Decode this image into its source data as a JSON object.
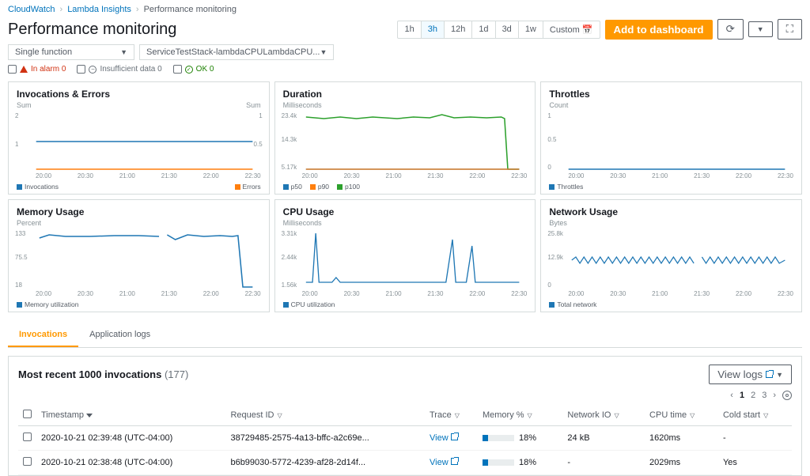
{
  "breadcrumb": {
    "root": "CloudWatch",
    "mid": "Lambda Insights",
    "cur": "Performance monitoring"
  },
  "title": "Performance monitoring",
  "time_ranges": [
    "1h",
    "3h",
    "12h",
    "1d",
    "3d",
    "1w",
    "Custom 📅"
  ],
  "time_active": "3h",
  "add_btn": "Add to dashboard",
  "selectors": {
    "mode": "Single function",
    "fn": "ServiceTestStack-lambdaCPULambdaCPU..."
  },
  "status": {
    "alarm": "In alarm 0",
    "insuf": "Insufficient data 0",
    "ok": "OK 0"
  },
  "panels": {
    "inv": {
      "title": "Invocations & Errors",
      "sub": "Sum",
      "sub2": "Sum",
      "legend": [
        "Invocations",
        "Errors"
      ]
    },
    "dur": {
      "title": "Duration",
      "sub": "Milliseconds",
      "legend": [
        "p50",
        "p90",
        "p100"
      ]
    },
    "thr": {
      "title": "Throttles",
      "sub": "Count",
      "legend": [
        "Throttles"
      ]
    },
    "mem": {
      "title": "Memory Usage",
      "sub": "Percent",
      "legend": [
        "Memory utilization"
      ]
    },
    "cpu": {
      "title": "CPU Usage",
      "sub": "Milliseconds",
      "legend": [
        "CPU utilization"
      ]
    },
    "net": {
      "title": "Network Usage",
      "sub": "Bytes",
      "legend": [
        "Total network"
      ]
    }
  },
  "xticks": [
    "20:00",
    "20:30",
    "21:00",
    "21:30",
    "22:00",
    "22:30"
  ],
  "chart_data": [
    {
      "type": "line",
      "title": "Invocations & Errors",
      "x": [
        "20:00",
        "20:30",
        "21:00",
        "21:30",
        "22:00",
        "22:30"
      ],
      "series": [
        {
          "name": "Invocations",
          "values": [
            1,
            1,
            1,
            1,
            1,
            1
          ]
        },
        {
          "name": "Errors",
          "values": [
            0,
            0,
            0,
            0,
            0,
            0
          ]
        }
      ],
      "ylim_left": [
        0,
        2
      ],
      "ylim_right": [
        0,
        1
      ],
      "ylabel": "Sum"
    },
    {
      "type": "line",
      "title": "Duration",
      "x": [
        "20:00",
        "20:30",
        "21:00",
        "21:30",
        "22:00",
        "22:30"
      ],
      "series": [
        {
          "name": "p50",
          "values": [
            5170,
            5170,
            5170,
            5170,
            5170,
            5170
          ]
        },
        {
          "name": "p90",
          "values": [
            5170,
            5170,
            5170,
            5170,
            5170,
            5170
          ]
        },
        {
          "name": "p100",
          "values": [
            23000,
            22800,
            22900,
            22800,
            23400,
            22700
          ]
        }
      ],
      "ylim": [
        5170,
        23400
      ],
      "ylabel": "Milliseconds",
      "note": "p100 drops sharply to ~5170 after 22:30"
    },
    {
      "type": "line",
      "title": "Throttles",
      "x": [
        "20:00",
        "20:30",
        "21:00",
        "21:30",
        "22:00",
        "22:30"
      ],
      "series": [
        {
          "name": "Throttles",
          "values": [
            0,
            0,
            0,
            0,
            0,
            0
          ]
        }
      ],
      "ylim": [
        0,
        1
      ],
      "ylabel": "Count"
    },
    {
      "type": "line",
      "title": "Memory Usage",
      "x": [
        "20:00",
        "20:30",
        "21:00",
        "21:30",
        "22:00",
        "22:30"
      ],
      "series": [
        {
          "name": "Memory utilization",
          "values": [
            128,
            128,
            128,
            127,
            129,
            128
          ]
        }
      ],
      "ylim": [
        18,
        133
      ],
      "ylabel": "Percent",
      "note": "drops to ~18 after 22:30"
    },
    {
      "type": "line",
      "title": "CPU Usage",
      "x": [
        "20:00",
        "20:30",
        "21:00",
        "21:30",
        "22:00",
        "22:30"
      ],
      "series": [
        {
          "name": "CPU utilization",
          "values": [
            1650,
            1650,
            1650,
            1650,
            1650,
            1650
          ]
        }
      ],
      "ylim": [
        1560,
        3310
      ],
      "ylabel": "Milliseconds",
      "note": "occasional spikes near 3310 around 20:05 and 22:00"
    },
    {
      "type": "line",
      "title": "Network Usage",
      "x": [
        "20:00",
        "20:30",
        "21:00",
        "21:30",
        "22:00",
        "22:30"
      ],
      "series": [
        {
          "name": "Total network",
          "values": [
            13000,
            13000,
            13000,
            13000,
            13000,
            13000
          ]
        }
      ],
      "ylim": [
        0,
        25800
      ],
      "ylabel": "Bytes",
      "note": "rapid oscillation around ~12.9k"
    }
  ],
  "tabs": {
    "inv": "Invocations",
    "logs": "Application logs"
  },
  "table": {
    "title": "Most recent 1000 invocations",
    "count": "(177)",
    "view_logs": "View logs",
    "pages": [
      "1",
      "2",
      "3"
    ],
    "headers": [
      "Timestamp",
      "Request ID",
      "Trace",
      "Memory %",
      "Network IO",
      "CPU time",
      "Cold start"
    ],
    "rows": [
      {
        "ts": "2020-10-21 02:39:48 (UTC-04:00)",
        "rid": "38729485-2575-4a13-bffc-a2c69e...",
        "trace": "View",
        "mem": "18%",
        "net": "24 kB",
        "cpu": "1620ms",
        "cold": "-"
      },
      {
        "ts": "2020-10-21 02:38:48 (UTC-04:00)",
        "rid": "b6b99030-5772-4239-af28-2d14f...",
        "trace": "View",
        "mem": "18%",
        "net": "-",
        "cpu": "2029ms",
        "cold": "Yes"
      }
    ]
  }
}
